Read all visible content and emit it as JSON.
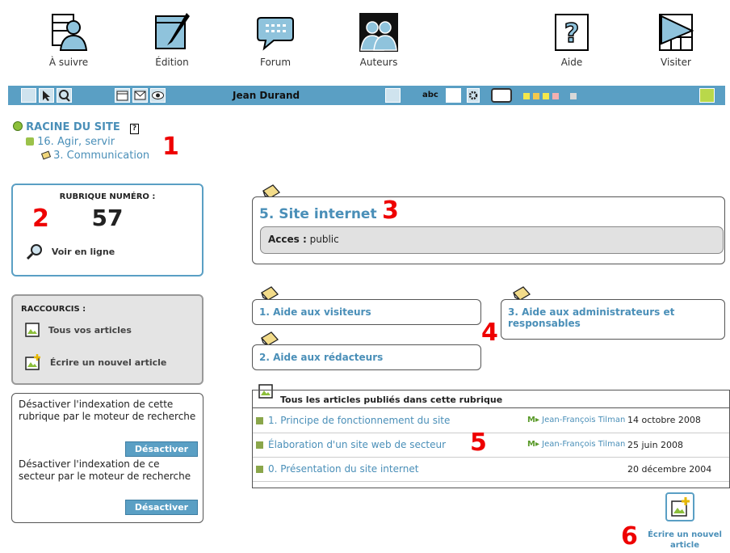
{
  "top_menu": [
    {
      "label": "À suivre",
      "icon": "person-icon"
    },
    {
      "label": "Édition",
      "icon": "pen-icon"
    },
    {
      "label": "Forum",
      "icon": "speech-bubble-icon"
    },
    {
      "label": "Auteurs",
      "icon": "people-icon"
    },
    {
      "label": "Aide",
      "icon": "help-icon"
    },
    {
      "label": "Visiter",
      "icon": "visit-flag-icon"
    }
  ],
  "toolbar": {
    "user": "Jean Durand",
    "abc_label": "abc",
    "color_squares": [
      "#f5e74a",
      "#f3c94c",
      "#f5e74a",
      "#f5b0b0",
      "#d8d8d8"
    ]
  },
  "breadcrumb": {
    "root": "RACINE DU SITE",
    "help": "?",
    "level1": "16. Agir, servir",
    "level2": "3. Communication"
  },
  "rubrique": {
    "label": "RUBRIQUE NUMÉRO :",
    "number": "57",
    "view_online": "Voir en ligne"
  },
  "shortcuts": {
    "title": "RACCOURCIS :",
    "items": [
      "Tous vos articles",
      "Écrire un nouvel article"
    ]
  },
  "indexing": {
    "text1": "Désactiver l'indexation de cette rubrique par le moteur de recherche",
    "button1": "Désactiver",
    "text2": "Désactiver l'indexation de ce secteur par le moteur de recherche",
    "button2": "Désactiver"
  },
  "main": {
    "title": "5. Site internet",
    "access_label": "Acces :",
    "access_value": "public",
    "subrubriques": [
      "1. Aide aux visiteurs",
      "3. Aide aux administrateurs et responsables",
      "2. Aide aux rédacteurs"
    ],
    "articles_header": "Tous les articles publiés dans cette rubrique",
    "articles": [
      {
        "title": "1. Principe de fonctionnement du site",
        "author": "Jean-François Tilman",
        "date": "14 octobre 2008"
      },
      {
        "title": "Élaboration d'un site web de secteur",
        "author": "Jean-François Tilman",
        "date": "25 juin 2008"
      },
      {
        "title": "0. Présentation du site internet",
        "author": "",
        "date": "20 décembre 2004"
      }
    ],
    "new_article": "Écrire un nouvel article"
  },
  "annotations": [
    "1",
    "2",
    "3",
    "4",
    "5",
    "6"
  ],
  "colors": {
    "accent": "#5a9fc4",
    "link": "#4a8fb8",
    "annotation": "#e00000"
  }
}
